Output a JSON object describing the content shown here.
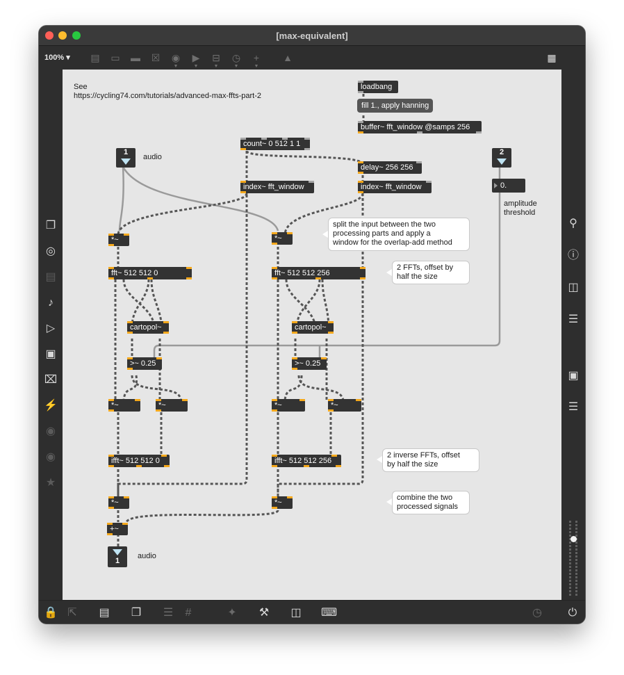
{
  "window": {
    "title": "[max-equivalent]"
  },
  "toolbar": {
    "zoom": "100% ▾",
    "icons": [
      "presentation-icon",
      "comment-icon",
      "message-icon",
      "toggle-icon",
      "button-icon",
      "number-icon",
      "slider-icon",
      "dial-icon",
      "plus-icon",
      "paint-bucket-icon",
      "grid-icon"
    ]
  },
  "left_sidebar": [
    "packages-icon",
    "target-icon",
    "video-icon",
    "music-note-icon",
    "media-icon",
    "image-icon",
    "paperclip-icon",
    "plug-icon",
    "vst-icon",
    "bpatcher-icon",
    "star-icon"
  ],
  "right_sidebar": [
    "search-icon",
    "info-icon",
    "book-icon",
    "list-icon",
    "camera-icon",
    "mixer-icon"
  ],
  "bottom_bar": [
    "lock-icon",
    "edit-icon",
    "presentation-icon",
    "overlap-icon",
    "align-icon",
    "grid-icon",
    "pin-icon",
    "wrench-icon",
    "piano-icon",
    "keyboard-icon",
    "clock-icon",
    "power-icon"
  ],
  "patch": {
    "see_label": "See\nhttps://cycling74.com/tutorials/advanced-max-ffts-part-2",
    "loadbang": "loadbang",
    "fill_msg": "fill 1., apply hanning",
    "buffer": "buffer~ fft_window @samps 256",
    "count": "count~ 0 512 1 1",
    "delay": "delay~ 256 256",
    "index1": "index~ fft_window",
    "index2": "index~ fft_window",
    "inlet1": "1",
    "inlet1_label": "audio",
    "inlet2": "2",
    "threshold_value": "0.",
    "threshold_label": "amplitude\nthreshold",
    "mul_left_in": "*~",
    "mul_right_in": "*~",
    "split_note": "split the input between the two\nprocessing parts and apply a\nwindow for the overlap-add method",
    "fft_left": "fft~ 512 512 0",
    "fft_right": "fft~ 512 512 256",
    "fft_note": "2 FFTs, offset by\nhalf the size",
    "cartopol_left": "cartopol~",
    "cartopol_right": "cartopol~",
    "gt_left": ">~ 0.25",
    "gt_right": ">~ 0.25",
    "mul_l1": "*~",
    "mul_l2": "*~",
    "mul_r1": "*~",
    "mul_r2": "*~",
    "ifft_left": "ifft~ 512 512 0",
    "ifft_right": "ifft~ 512 512 256",
    "ifft_note": "2 inverse FFTs, offset\nby half the size",
    "mul_left_out": "*~",
    "mul_right_out": "*~",
    "combine_note": "combine the two\nprocessed signals",
    "plus": "+~",
    "outlet1": "1",
    "outlet1_label": "audio"
  }
}
